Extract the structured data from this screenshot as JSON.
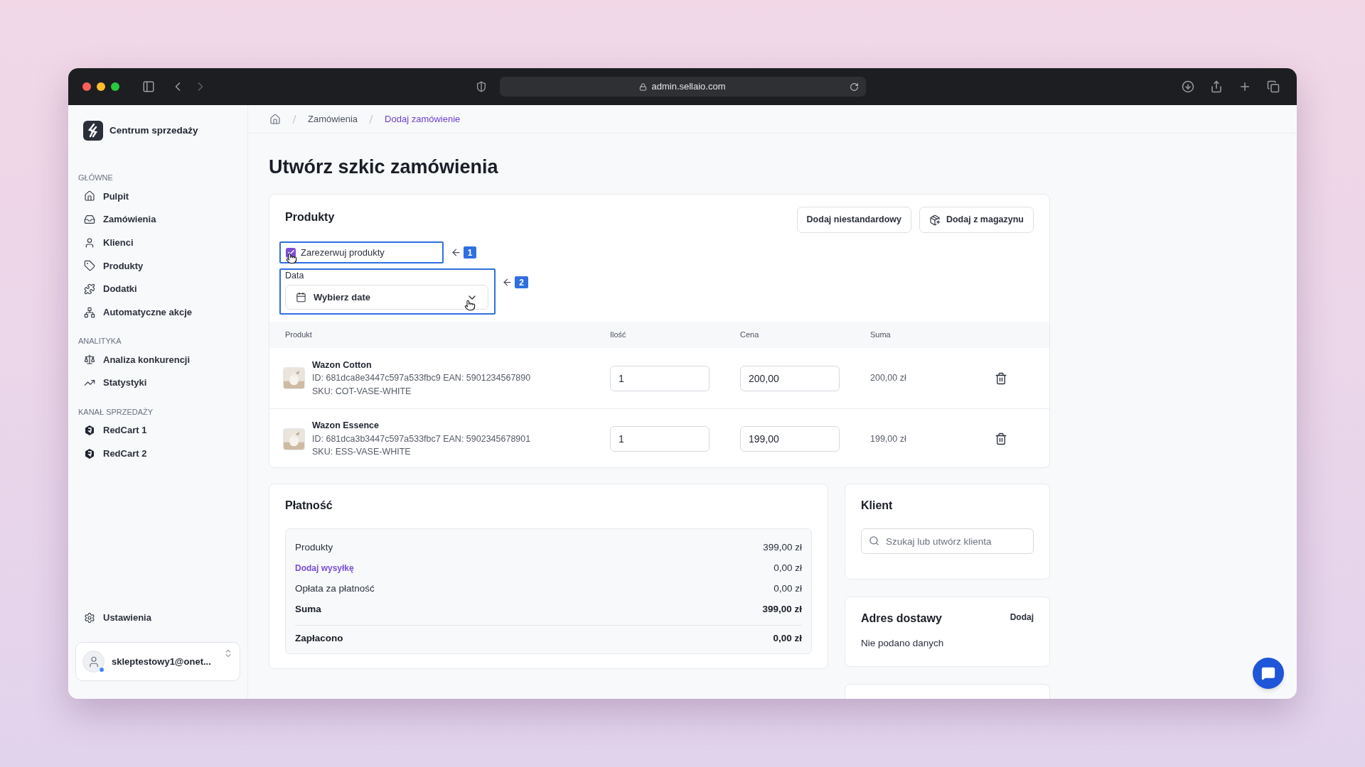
{
  "browser": {
    "url": "admin.sellaio.com"
  },
  "sidebar": {
    "brand": "Centrum sprzedaży",
    "sections": [
      {
        "title": "GŁÓWNE",
        "items": [
          {
            "label": "Pulpit",
            "kind": "home"
          },
          {
            "label": "Zamówienia",
            "kind": "inbox"
          },
          {
            "label": "Klienci",
            "kind": "user"
          },
          {
            "label": "Produkty",
            "kind": "tag"
          },
          {
            "label": "Dodatki",
            "kind": "puzzle"
          },
          {
            "label": "Automatyczne akcje",
            "kind": "network"
          }
        ]
      },
      {
        "title": "ANALITYKA",
        "items": [
          {
            "label": "Analiza konkurencji",
            "kind": "scale"
          },
          {
            "label": "Statystyki",
            "kind": "trend"
          }
        ]
      },
      {
        "title": "KANAŁ SPRZEDAŻY",
        "items": [
          {
            "label": "RedCart 1",
            "kind": "hexagon"
          },
          {
            "label": "RedCart 2",
            "kind": "hexagon"
          }
        ]
      }
    ],
    "settings": "Ustawienia",
    "user": "skleptestowy1@onet..."
  },
  "breadcrumb": [
    {
      "label": "Zamówienia",
      "current": false
    },
    {
      "label": "Dodaj zamówienie",
      "current": true
    }
  ],
  "page_title": "Utwórz szkic zamówienia",
  "products": {
    "title": "Produkty",
    "buttons": [
      {
        "label": "Dodaj niestandardowy",
        "kind": "plain"
      },
      {
        "label": "Dodaj z magazynu",
        "kind": "box"
      }
    ],
    "reserve": {
      "label": "Zarezerwuj produkty",
      "checked": true
    },
    "date": {
      "label": "Data",
      "picker": "Wybierz date"
    },
    "annotations": [
      "1",
      "2"
    ],
    "columns": [
      "Produkt",
      "Ilość",
      "Cena",
      "Suma"
    ],
    "rows": [
      {
        "name": "Wazon Cotton",
        "details": [
          "ID: 681dca8e3447c597a533fbc9 EAN: 5901234567890",
          "SKU: COT-VASE-WHITE"
        ],
        "quantity": "1",
        "price": "200,00",
        "total": "200,00 zł"
      },
      {
        "name": "Wazon Essence",
        "details": [
          "ID: 681dca3b3447c597a533fbc7 EAN: 5902345678901",
          "SKU: ESS-VASE-WHITE"
        ],
        "quantity": "1",
        "price": "199,00",
        "total": "199,00 zł"
      }
    ]
  },
  "payment": {
    "title": "Płatność",
    "rows": [
      {
        "label": "Produkty",
        "value": "399,00 zł",
        "kind": "normal"
      },
      {
        "label": "Dodaj wysyłkę",
        "value": "0,00 zł",
        "kind": "link"
      },
      {
        "label": "Opłata za płatność",
        "value": "0,00 zł",
        "kind": "normal"
      },
      {
        "label": "Suma",
        "value": "399,00 zł",
        "kind": "total"
      },
      {
        "label": "Zapłacono",
        "value": "0,00 zł",
        "kind": "paid"
      }
    ]
  },
  "client": {
    "title": "Klient",
    "search": {
      "placeholder": "Szukaj lub utwórz klienta"
    }
  },
  "address": {
    "title": "Adres dostawy",
    "action": "Dodaj",
    "text": "Nie podano danych"
  }
}
